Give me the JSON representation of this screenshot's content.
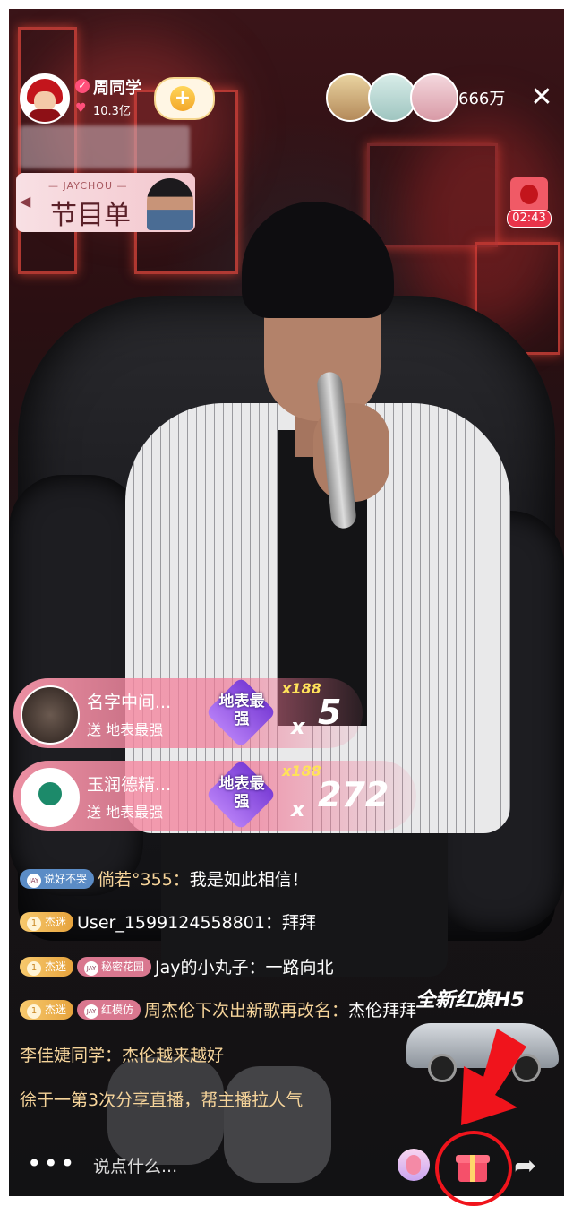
{
  "anchor": {
    "name": "周同学",
    "likes": "10.3亿"
  },
  "viewers": {
    "count": "666万"
  },
  "playlist": {
    "subtitle": "— JAYCHOU —",
    "title": "节目单"
  },
  "mini_timer": "02:43",
  "gifts": [
    {
      "name": "名字中间...",
      "send": "送 地表最强",
      "gift_label": "地表最强",
      "multiplier": "x188",
      "x": "x",
      "count": "5"
    },
    {
      "name": "玉润德精...",
      "send": "送 地表最强",
      "gift_label": "地表最强",
      "multiplier": "x188",
      "x": "x",
      "count": "272"
    }
  ],
  "chat": [
    {
      "badges": [
        {
          "type": "blue",
          "prefix": "JAY",
          "text": "说好不哭"
        }
      ],
      "user": "倘若°355：",
      "msg": "我是如此相信！"
    },
    {
      "badges": [
        {
          "type": "gold",
          "prefix": "1",
          "text": "杰迷"
        }
      ],
      "user": "User_1599124558801：",
      "msg": "拜拜"
    },
    {
      "badges": [
        {
          "type": "gold",
          "prefix": "1",
          "text": "杰迷"
        },
        {
          "type": "pink",
          "prefix": "JAY",
          "text": "秘密花园"
        }
      ],
      "user": "Jay的小丸子：",
      "msg": "一路向北"
    },
    {
      "badges": [
        {
          "type": "gold",
          "prefix": "1",
          "text": "杰迷"
        },
        {
          "type": "pink",
          "prefix": "JAY",
          "text": "红模仿"
        }
      ],
      "user": "周杰伦下次出新歌再改名：",
      "msg": "杰伦拜拜"
    },
    {
      "badges": [],
      "user": "李佳婕同学：",
      "msg": "杰伦越来越好"
    },
    {
      "badges": [],
      "user": "",
      "msg": "徐于一第3次分享直播，帮主播拉人气"
    }
  ],
  "ad": {
    "text": "全新红旗H5"
  },
  "bottom": {
    "more": "•••",
    "input_placeholder": "说点什么..."
  },
  "colors": {
    "highlight": "#f0141c",
    "accent": "#f5506a"
  },
  "icons": [
    "verified-icon",
    "heart-icon",
    "follow-plus-icon",
    "close-icon",
    "gift-icon",
    "share-icon",
    "effects-icon"
  ]
}
